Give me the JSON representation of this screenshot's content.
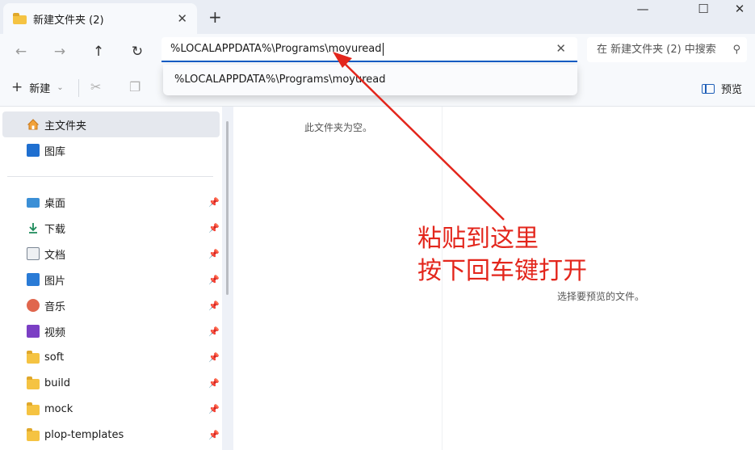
{
  "window": {
    "tab_title": "新建文件夹 (2)",
    "tab_close": "✕",
    "new_tab": "+",
    "minimize": "—",
    "maximize": "☐",
    "close": "✕"
  },
  "nav": {
    "back": "←",
    "forward": "→",
    "up": "↑",
    "refresh": "↻"
  },
  "address": {
    "value": "%LOCALAPPDATA%\\Programs\\moyuread",
    "clear": "✕",
    "suggestion": "%LOCALAPPDATA%\\Programs\\moyuread"
  },
  "search": {
    "placeholder": "在 新建文件夹 (2) 中搜索",
    "icon": "⚲"
  },
  "toolbar": {
    "new_label": "新建",
    "new_plus": "+",
    "new_chevron": "⌄",
    "cut_icon": "✂",
    "copy_icon": "❐",
    "preview_label": "预览"
  },
  "sidebar": {
    "top": [
      {
        "label": "主文件夹",
        "icon": "home-icon",
        "selected": true
      },
      {
        "label": "图库",
        "icon": "gallery-icon"
      }
    ],
    "items": [
      {
        "label": "桌面",
        "icon": "desktop-icon"
      },
      {
        "label": "下载",
        "icon": "download-icon"
      },
      {
        "label": "文档",
        "icon": "document-icon"
      },
      {
        "label": "图片",
        "icon": "pictures-icon"
      },
      {
        "label": "音乐",
        "icon": "music-icon"
      },
      {
        "label": "视频",
        "icon": "video-icon"
      },
      {
        "label": "soft",
        "icon": "folder-icon"
      },
      {
        "label": "build",
        "icon": "folder-icon"
      },
      {
        "label": "mock",
        "icon": "folder-icon"
      },
      {
        "label": "plop-templates",
        "icon": "folder-icon"
      }
    ],
    "pin_glyph": "📌"
  },
  "main": {
    "empty_text": "此文件夹为空。",
    "preview_text": "选择要预览的文件。"
  },
  "annotation": {
    "line1": "粘贴到这里",
    "line2": "按下回车键打开",
    "color": "#e3261c"
  }
}
